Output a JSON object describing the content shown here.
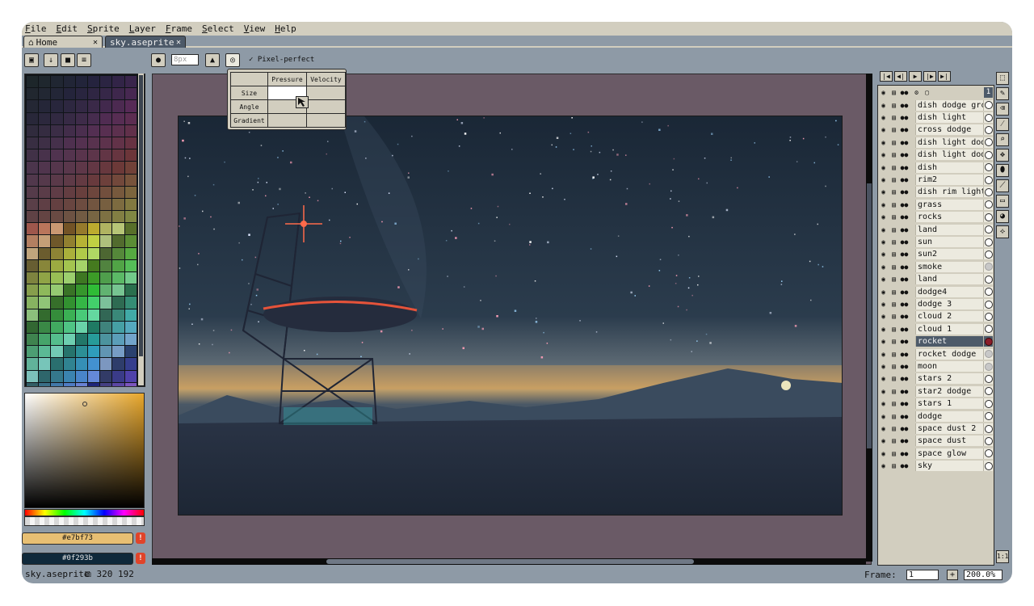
{
  "menu": [
    "File",
    "Edit",
    "Sprite",
    "Layer",
    "Frame",
    "Select",
    "View",
    "Help"
  ],
  "tabs": [
    {
      "label": "Home",
      "icon": "home-icon"
    },
    {
      "label": "sky.aseprite"
    }
  ],
  "toolbar": {
    "brush_size": "8px",
    "pixel_perfect_label": "Pixel-perfect",
    "pixel_perfect_checked": true
  },
  "dynamics": {
    "columns": [
      "Pressure",
      "Velocity"
    ],
    "rows": [
      "Size",
      "Angle",
      "Gradient"
    ]
  },
  "colors": {
    "foreground": "#e7bf73",
    "background": "#0f293b",
    "accent_layer": "#4d5a69",
    "panel": "#d2cebf"
  },
  "color_fields": {
    "foreground_hex": "#e7bf73",
    "background_hex": "#0f293b"
  },
  "layers": [
    "dish dodge grc",
    "dish light",
    "cross dodge",
    "dish light dodg",
    "dish light dodg",
    "dish",
    "rim2",
    "dish rim light",
    "grass",
    "rocks",
    "land",
    "sun",
    "sun2",
    "smoke",
    "land",
    "dodge4",
    "dodge 3",
    "cloud 2",
    "cloud 1",
    "rocket",
    "rocket dodge",
    "moon",
    "stars 2",
    "star2 dodge",
    "stars 1",
    "dodge",
    "space dust 2",
    "space dust",
    "space glow",
    "sky"
  ],
  "active_layer": "rocket",
  "frame_number": "1",
  "status": {
    "file": "sky.aseprite",
    "size": "320 192",
    "frame_label": "Frame:",
    "frame_value": "1",
    "zoom": "200.0%"
  }
}
